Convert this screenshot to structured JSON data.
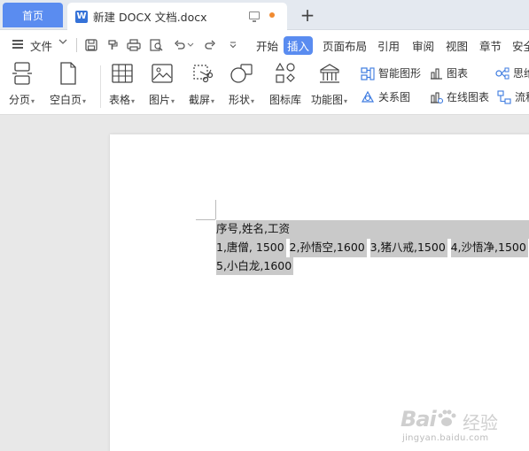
{
  "tabs": {
    "home_label": "首页",
    "doc_title": "新建 DOCX 文档.docx",
    "doc_icon_letter": "W",
    "new_tab_glyph": "+"
  },
  "menubar": {
    "file_label": "文件",
    "tabs": [
      "开始",
      "插入",
      "页面布局",
      "引用",
      "审阅",
      "视图",
      "章节",
      "安全"
    ],
    "active_tab": "插入"
  },
  "ribbon": {
    "buttons": [
      {
        "label": "分页",
        "icon": "page-break-icon"
      },
      {
        "label": "空白页",
        "icon": "blank-page-icon"
      },
      {
        "label": "表格",
        "icon": "table-icon"
      },
      {
        "label": "图片",
        "icon": "picture-icon"
      },
      {
        "label": "截屏",
        "icon": "screenshot-icon"
      },
      {
        "label": "形状",
        "icon": "shape-icon"
      },
      {
        "label": "图标库",
        "icon": "icon-library-icon"
      },
      {
        "label": "功能图",
        "icon": "function-chart-icon"
      }
    ],
    "small": {
      "smart_art": "智能图形",
      "chart": "图表",
      "relation": "关系图",
      "online_chart": "在线图表",
      "mindmap": "思维",
      "flow": "流程"
    }
  },
  "document": {
    "lines": [
      "序号,姓名,工资",
      "1,唐僧, 1500",
      "2,孙悟空,1600",
      "3,猪八戒,1500",
      "4,沙悟净,1500",
      "5,小白龙,1600"
    ]
  },
  "watermark": {
    "logo_text_left": "Bai",
    "logo_text_right": "经验",
    "url": "jingyan.baidu.com"
  },
  "colors": {
    "accent": "#5a8cf0",
    "selection": "#c9c9c9",
    "tab_dot": "#f08a30"
  }
}
